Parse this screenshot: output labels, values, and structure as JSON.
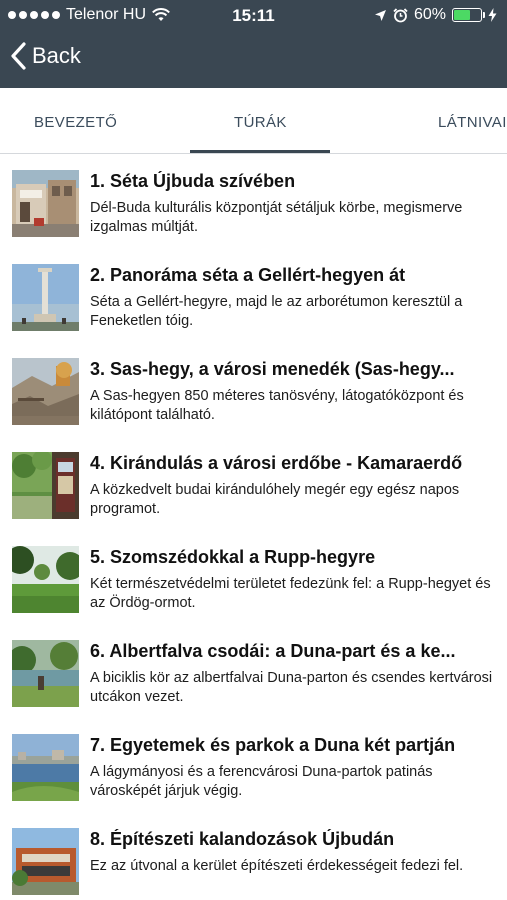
{
  "status_bar": {
    "carrier": "Telenor HU",
    "time": "15:11",
    "battery": "60%",
    "battery_level": 0.6,
    "signal_bars": 5
  },
  "nav": {
    "back_label": "Back"
  },
  "tabs": [
    {
      "label": "BEVEZETŐ",
      "selected": false
    },
    {
      "label": "TÚRÁK",
      "selected": true
    },
    {
      "label": "LÁTNIVAI",
      "selected": false
    }
  ],
  "tours": [
    {
      "title": "1. Séta Újbuda szívében",
      "description": "Dél-Buda kulturális központját sétáljuk körbe, megismerve izgalmas múltját."
    },
    {
      "title": "2. Panoráma séta a Gellért-hegyen át",
      "description": "Séta a Gellért-hegyre, majd le az arborétumon keresztül a Feneketlen tóig."
    },
    {
      "title": "3. Sas-hegy, a városi menedék (Sas-hegy...",
      "description": "A Sas-hegyen 850 méteres tanösvény, látogatóközpont és kilátópont található."
    },
    {
      "title": "4. Kirándulás a városi erdőbe - Kamaraerdő",
      "description": "A közkedvelt budai kirándulóhely megér egy egész napos programot."
    },
    {
      "title": "5. Szomszédokkal a Rupp-hegyre",
      "description": "Két természetvédelmi területet fedezünk fel: a Rupp-hegyet és az Ördög-ormot."
    },
    {
      "title": "6. Albertfalva csodái: a Duna-part és a ke...",
      "description": "A biciklis kör az albertfalvai Duna-parton és csendes kertvárosi utcákon vezet."
    },
    {
      "title": "7. Egyetemek és parkok a Duna két partján",
      "description": "A lágymányosi és a ferencvárosi Duna-partok patinás városképét járjuk végig."
    },
    {
      "title": "8. Építészeti kalandozások Újbudán",
      "description": "Ez az útvonal a kerület építészeti érdekességeit fedezi fel."
    }
  ],
  "colors": {
    "header_bg": "#3a4752",
    "tab_text": "#3b4c5c",
    "battery_fill": "#4cd964"
  }
}
